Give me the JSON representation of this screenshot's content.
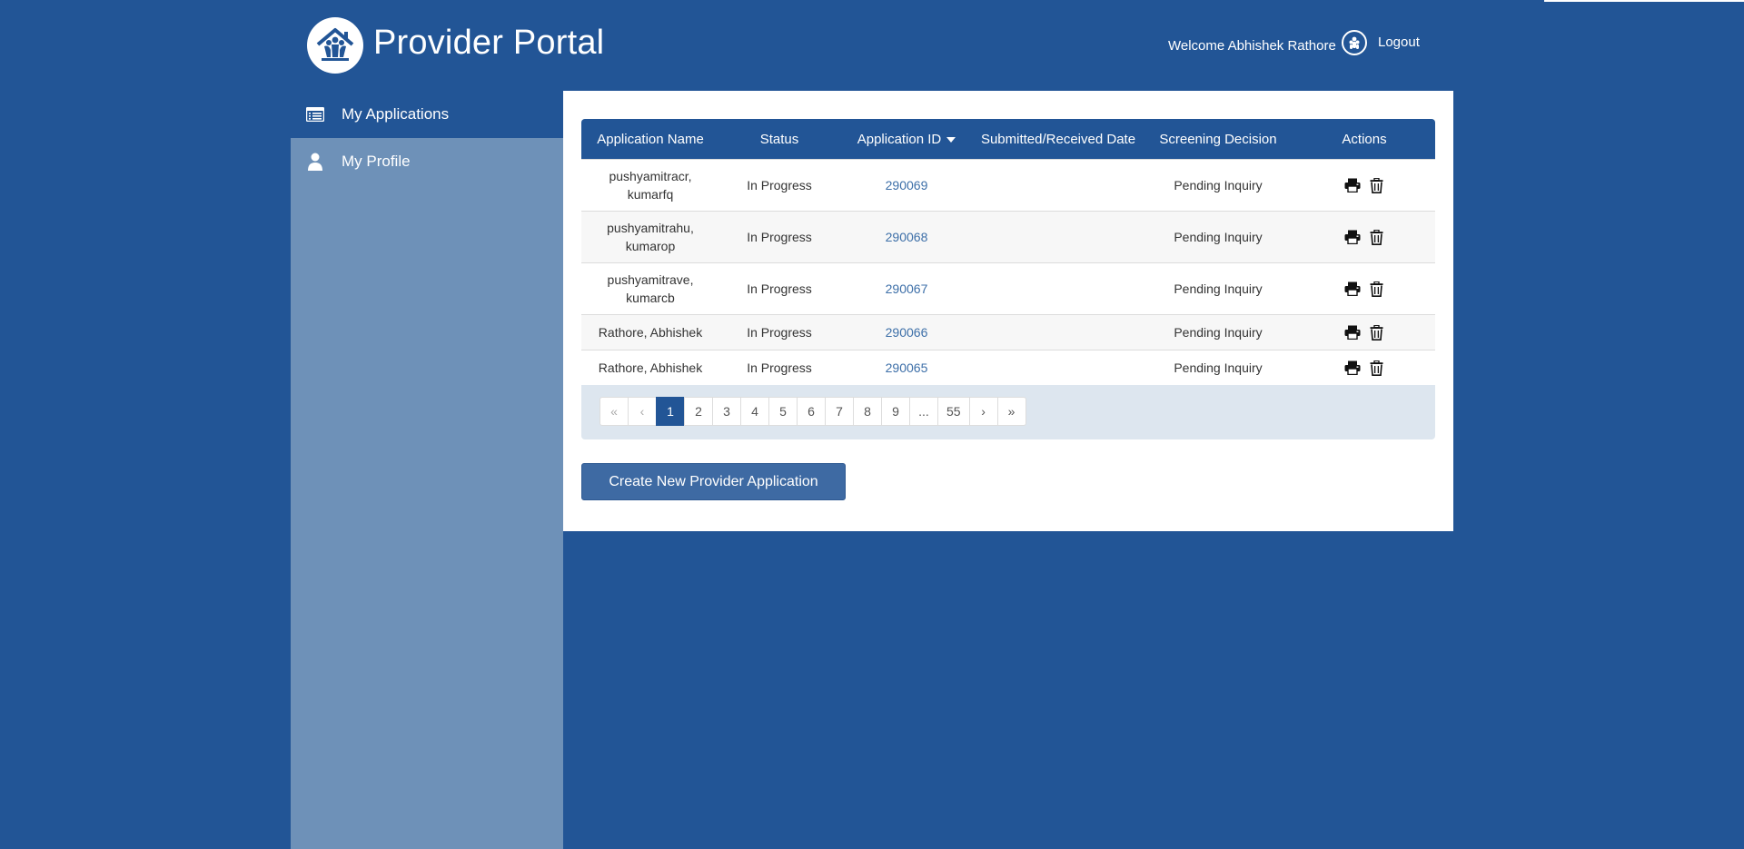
{
  "header": {
    "title": "Provider Portal",
    "welcome": "Welcome Abhishek Rathore",
    "logout": "Logout"
  },
  "sidebar": {
    "items": [
      {
        "label": "My Applications",
        "icon": "list-icon",
        "active": true
      },
      {
        "label": "My Profile",
        "icon": "user-icon",
        "active": false
      }
    ]
  },
  "table": {
    "columns": [
      "Application Name",
      "Status",
      "Application ID",
      "Submitted/Received Date",
      "Screening Decision",
      "Actions"
    ],
    "sort_column": "Application ID",
    "rows": [
      {
        "name": "pushyamitracr, kumarfq",
        "status": "In Progress",
        "id": "290069",
        "date": "",
        "decision": "Pending Inquiry"
      },
      {
        "name": "pushyamitrahu, kumarop",
        "status": "In Progress",
        "id": "290068",
        "date": "",
        "decision": "Pending Inquiry"
      },
      {
        "name": "pushyamitrave, kumarcb",
        "status": "In Progress",
        "id": "290067",
        "date": "",
        "decision": "Pending Inquiry"
      },
      {
        "name": "Rathore, Abhishek",
        "status": "In Progress",
        "id": "290066",
        "date": "",
        "decision": "Pending Inquiry"
      },
      {
        "name": "Rathore, Abhishek",
        "status": "In Progress",
        "id": "290065",
        "date": "",
        "decision": "Pending Inquiry"
      }
    ]
  },
  "pagination": {
    "items": [
      "«",
      "‹",
      "1",
      "2",
      "3",
      "4",
      "5",
      "6",
      "7",
      "8",
      "9",
      "...",
      "55",
      "›",
      "»"
    ],
    "current": "1"
  },
  "create_button": "Create New Provider Application",
  "colors": {
    "brand": "#225596",
    "sidebar": "#6e91b8",
    "link": "#3d6fa8"
  }
}
